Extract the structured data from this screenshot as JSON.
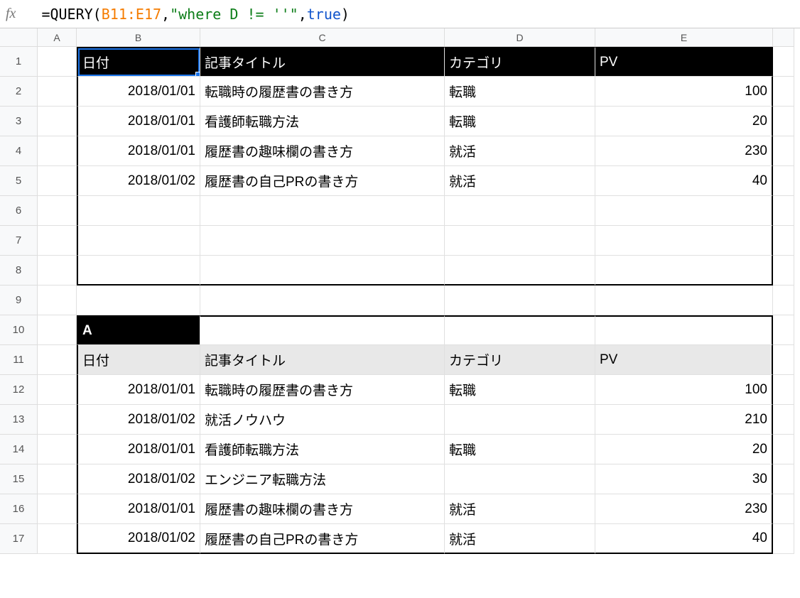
{
  "fx_label": "fx",
  "formula": {
    "p1": "=QUERY(",
    "range": "B11:E17",
    "p2": ",",
    "string": "\"where D != ''\"",
    "p3": ",",
    "bool": "true",
    "p4": ")"
  },
  "columns": [
    "A",
    "B",
    "C",
    "D",
    "E"
  ],
  "rows": [
    "1",
    "2",
    "3",
    "4",
    "5",
    "6",
    "7",
    "8",
    "9",
    "10",
    "11",
    "12",
    "13",
    "14",
    "15",
    "16",
    "17"
  ],
  "top_table": {
    "headers": {
      "b": "日付",
      "c": "記事タイトル",
      "d": "カテゴリ",
      "e": "PV"
    },
    "data": [
      {
        "b": "2018/01/01",
        "c": "転職時の履歴書の書き方",
        "d": "転職",
        "e": "100"
      },
      {
        "b": "2018/01/01",
        "c": "看護師転職方法",
        "d": "転職",
        "e": "20"
      },
      {
        "b": "2018/01/01",
        "c": "履歴書の趣味欄の書き方",
        "d": "就活",
        "e": "230"
      },
      {
        "b": "2018/01/02",
        "c": "履歴書の自己PRの書き方",
        "d": "就活",
        "e": "40"
      }
    ]
  },
  "bottom_table": {
    "label_a": "A",
    "headers": {
      "b": "日付",
      "c": "記事タイトル",
      "d": "カテゴリ",
      "e": "PV"
    },
    "data": [
      {
        "b": "2018/01/01",
        "c": "転職時の履歴書の書き方",
        "d": "転職",
        "e": "100"
      },
      {
        "b": "2018/01/02",
        "c": "就活ノウハウ",
        "d": "",
        "e": "210"
      },
      {
        "b": "2018/01/01",
        "c": "看護師転職方法",
        "d": "転職",
        "e": "20"
      },
      {
        "b": "2018/01/02",
        "c": "エンジニア転職方法",
        "d": "",
        "e": "30"
      },
      {
        "b": "2018/01/01",
        "c": "履歴書の趣味欄の書き方",
        "d": "就活",
        "e": "230"
      },
      {
        "b": "2018/01/02",
        "c": "履歴書の自己PRの書き方",
        "d": "就活",
        "e": "40"
      }
    ]
  }
}
